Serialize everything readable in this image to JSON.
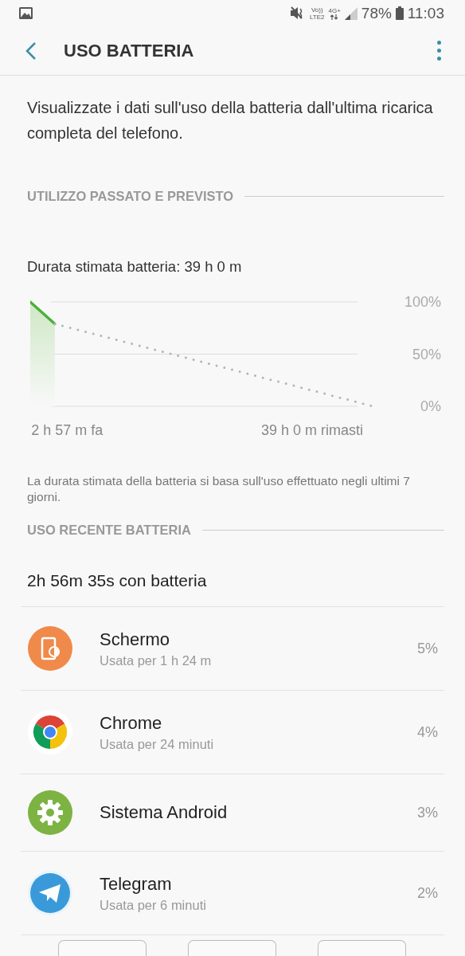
{
  "status_bar": {
    "volte_top": "Vo))",
    "volte_bottom": "LTE2",
    "network": "4G+",
    "battery": "78%",
    "time": "11:03"
  },
  "header": {
    "title": "USO BATTERIA"
  },
  "description": "Visualizzate i dati sull'uso della batteria dall'ultima ricarica completa del telefono.",
  "past_section": {
    "title": "UTILIZZO PASSATO E PREVISTO",
    "estimate": "Durata stimata batteria: 39 h 0 m",
    "chart_data": {
      "type": "line",
      "categories": [
        null,
        null,
        null,
        "2 h 57 m fa",
        null,
        null,
        null,
        null,
        null,
        null,
        null,
        null,
        null,
        null,
        null,
        null,
        null,
        null,
        null,
        null,
        null,
        null,
        null,
        "39 h 0 m rimasti",
        null,
        null,
        null,
        null,
        null
      ],
      "ylim": [
        0,
        100
      ],
      "yticks": [
        {
          "value": 0,
          "label": "0%"
        },
        {
          "value": 50,
          "label": "50%"
        },
        {
          "value": 100,
          "label": "100%"
        }
      ],
      "series": [
        {
          "color": "#4caf3a",
          "values": [
            100,
            89.5,
            79,
            null,
            null,
            null,
            null,
            null,
            null,
            null,
            null,
            null,
            null,
            null,
            null,
            null,
            null,
            null,
            null,
            null,
            null,
            null,
            null,
            null,
            null,
            null,
            null,
            null,
            null
          ]
        },
        {
          "color": "#a9b6bd",
          "line_style": "dotted",
          "values": [
            null,
            null,
            79,
            76,
            72.9,
            69.9,
            66.8,
            63.8,
            60.8,
            57.7,
            54.7,
            51.7,
            48.6,
            45.6,
            42.5,
            39.5,
            36.5,
            33.4,
            30.4,
            27.3,
            24.3,
            21.3,
            18.2,
            15.2,
            12.2,
            9.1,
            6.1,
            3,
            0
          ]
        }
      ]
    },
    "note": "La durata stimata della batteria si basa sull'uso effettuato negli ultimi 7 giorni."
  },
  "recent_section": {
    "title": "USO RECENTE BATTERIA",
    "summary": "2h 56m 35s con batteria",
    "apps": [
      {
        "name": "Schermo",
        "usage": "Usata per 1 h 24 m",
        "percent": "5%"
      },
      {
        "name": "Chrome",
        "usage": "Usata per 24 minuti",
        "percent": "4%"
      },
      {
        "name": "Sistema Android",
        "percent": "3%"
      },
      {
        "name": "Telegram",
        "usage": "Usata per 6 minuti",
        "percent": "2%"
      }
    ]
  }
}
